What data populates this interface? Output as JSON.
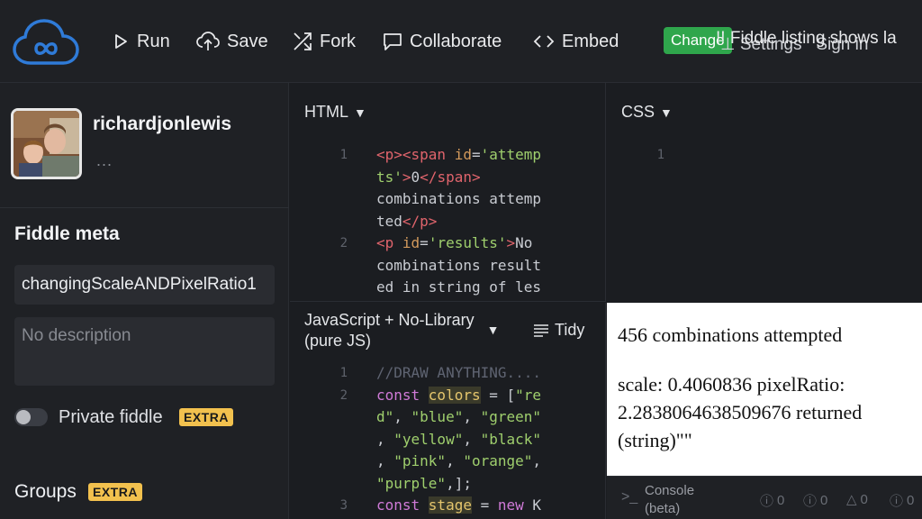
{
  "topbar": {
    "run_label": "Run",
    "save_label": "Save",
    "fork_label": "Fork",
    "collaborate_label": "Collaborate",
    "embed_label": "Embed",
    "change_label": "Change",
    "notice_text": "!! Fiddle listing shows la",
    "settings_label": "Settings",
    "signin_label": "Sign in"
  },
  "sidebar": {
    "username": "richardjonlewis",
    "user_more": "...",
    "meta_title": "Fiddle meta",
    "fiddle_name": "changingScaleANDPixelRatio1",
    "description_placeholder": "No description",
    "private_label": "Private fiddle",
    "private_badge": "EXTRA",
    "groups_label": "Groups",
    "groups_badge": "EXTRA"
  },
  "html_panel": {
    "title": "HTML",
    "line_numbers": [
      "1",
      "2"
    ],
    "lines": [
      {
        "parts": [
          [
            "tag",
            "<p><span "
          ],
          [
            "attr",
            "id"
          ],
          [
            "txt",
            "="
          ],
          [
            "str",
            "'attemp"
          ]
        ]
      },
      {
        "parts": [
          [
            "str",
            "ts'"
          ],
          [
            "tag",
            ">"
          ],
          [
            "txt",
            "0"
          ],
          [
            "tag",
            "</span>"
          ]
        ]
      },
      {
        "parts": [
          [
            "txt",
            "combinations attemp"
          ]
        ]
      },
      {
        "parts": [
          [
            "txt",
            "ted"
          ],
          [
            "tag",
            "</p>"
          ]
        ]
      },
      {
        "parts": [
          [
            "tag",
            "<p "
          ],
          [
            "attr",
            "id"
          ],
          [
            "txt",
            "="
          ],
          [
            "str",
            "'results'"
          ],
          [
            "tag",
            ">"
          ],
          [
            "txt",
            "No"
          ]
        ]
      },
      {
        "parts": [
          [
            "txt",
            "combinations result"
          ]
        ]
      },
      {
        "parts": [
          [
            "txt",
            "ed in string of les"
          ]
        ]
      }
    ]
  },
  "css_panel": {
    "title": "CSS",
    "line_numbers": [
      "1"
    ]
  },
  "js_panel": {
    "title_line1": "JavaScript + No-Library",
    "title_line2": "(pure JS)",
    "tidy_label": "Tidy",
    "line_numbers": [
      "1",
      "2",
      "3"
    ],
    "lines": [
      {
        "parts": [
          [
            "cmt",
            "//DRAW ANYTHING...."
          ]
        ]
      },
      {
        "parts": [
          [
            "kw",
            "const "
          ],
          [
            "hl",
            "colors"
          ],
          [
            "txt",
            " = ["
          ],
          [
            "str",
            "\"re"
          ]
        ]
      },
      {
        "parts": [
          [
            "str",
            "d\""
          ],
          [
            "txt",
            ", "
          ],
          [
            "str",
            "\"blue\""
          ],
          [
            "txt",
            ", "
          ],
          [
            "str",
            "\"green\""
          ]
        ]
      },
      {
        "parts": [
          [
            "txt",
            ", "
          ],
          [
            "str",
            "\"yellow\""
          ],
          [
            "txt",
            ", "
          ],
          [
            "str",
            "\"black\""
          ]
        ]
      },
      {
        "parts": [
          [
            "txt",
            ", "
          ],
          [
            "str",
            "\"pink\""
          ],
          [
            "txt",
            ", "
          ],
          [
            "str",
            "\"orange\""
          ],
          [
            "txt",
            ","
          ]
        ]
      },
      {
        "parts": [
          [
            "str",
            "\"purple\""
          ],
          [
            "txt",
            ",];"
          ]
        ]
      },
      {
        "parts": [
          [
            "kw",
            "const "
          ],
          [
            "hl",
            "stage"
          ],
          [
            "txt",
            " = "
          ],
          [
            "kw",
            "new "
          ],
          [
            "txt",
            "K"
          ]
        ]
      }
    ]
  },
  "result": {
    "line1": "456 combinations attempted",
    "line2": "scale: 0.4060836 pixelRatio: 2.2838064638509676 returned (string)\"\""
  },
  "console": {
    "label_line1": "Console",
    "label_line2": "(beta)",
    "counts": [
      "0",
      "0",
      "0",
      "0"
    ]
  },
  "colors": {
    "change_button": "#2fa64c",
    "badge": "#f2c14e",
    "logo": "#2f7bd8"
  }
}
